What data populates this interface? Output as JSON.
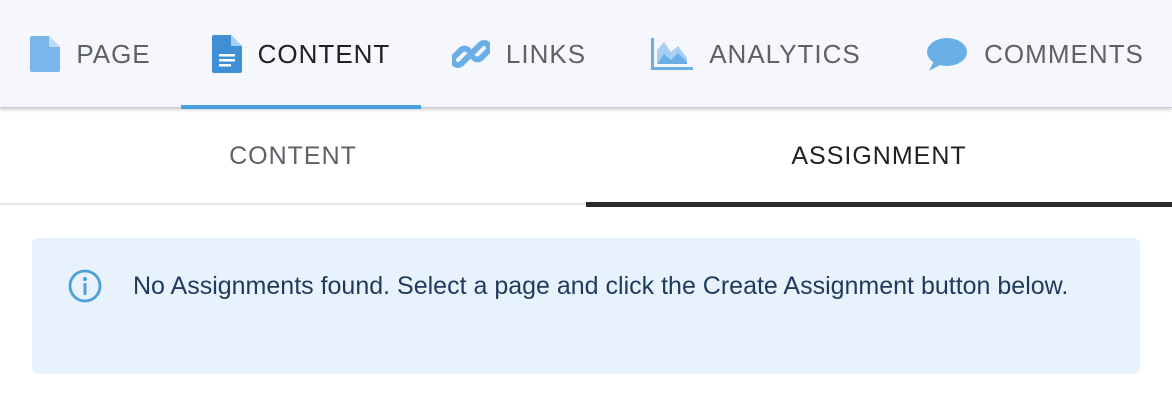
{
  "top_tabs": [
    {
      "label": "PAGE",
      "icon": "document-icon",
      "active": false
    },
    {
      "label": "CONTENT",
      "icon": "document-lines-icon",
      "active": true
    },
    {
      "label": "LINKS",
      "icon": "link-icon",
      "active": false
    },
    {
      "label": "ANALYTICS",
      "icon": "area-chart-icon",
      "active": false
    },
    {
      "label": "COMMENTS",
      "icon": "speech-bubble-icon",
      "active": false
    }
  ],
  "sub_tabs": [
    {
      "label": "CONTENT",
      "active": false
    },
    {
      "label": "ASSIGNMENT",
      "active": true
    }
  ],
  "alert": {
    "icon": "info-circle-icon",
    "message": "No Assignments found. Select a page and click the Create Assignment button below."
  },
  "colors": {
    "accent": "#4a9fdc",
    "icon_blue": "#6aaee6",
    "active_subtab_underline": "#2b2b2d",
    "alert_bg": "#e8f2fc",
    "alert_text": "#1e3a5c"
  }
}
